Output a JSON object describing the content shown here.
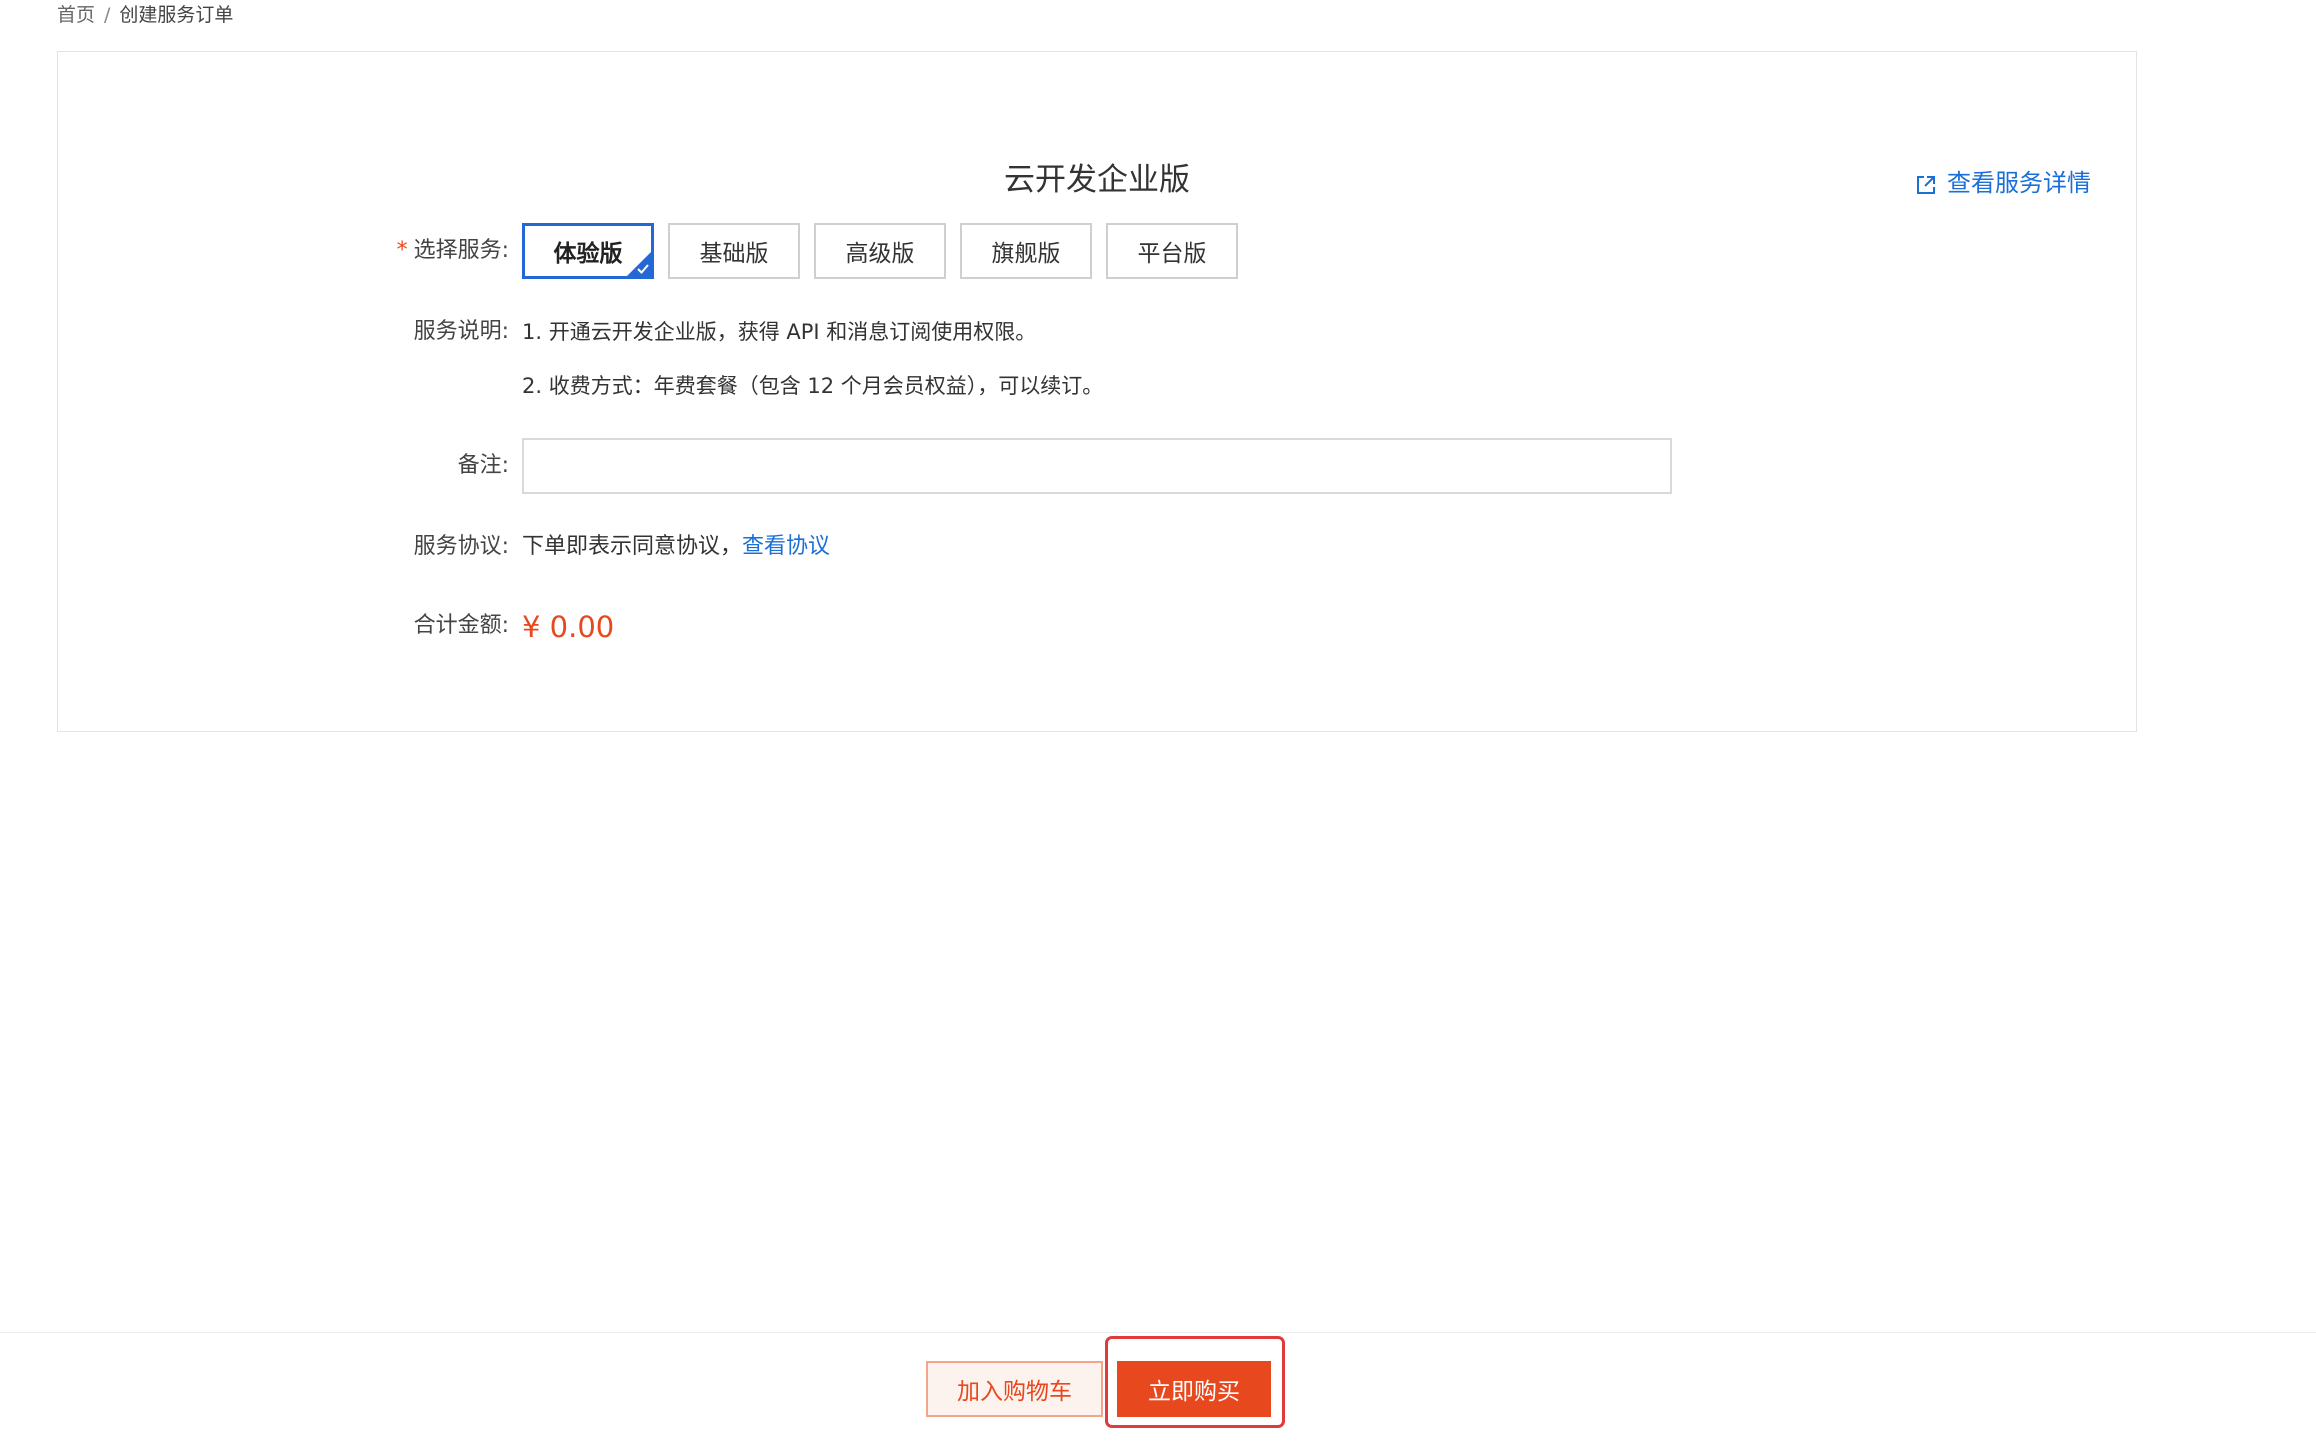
{
  "breadcrumb": {
    "home": "首页",
    "separator": "/",
    "current": "创建服务订单"
  },
  "card": {
    "title": "云开发企业版",
    "detail_link": "查看服务详情"
  },
  "service_select": {
    "required_mark": "*",
    "label": "选择服务:",
    "options": [
      "体验版",
      "基础版",
      "高级版",
      "旗舰版",
      "平台版"
    ],
    "selected": "体验版"
  },
  "description": {
    "label": "服务说明:",
    "lines": [
      "1. 开通云开发企业版，获得 API 和消息订阅使用权限。",
      "2. 收费方式：年费套餐（包含 12 个月会员权益），可以续订。"
    ]
  },
  "remark": {
    "label": "备注:",
    "value": "",
    "placeholder": ""
  },
  "agreement": {
    "label": "服务协议:",
    "text": "下单即表示同意协议，",
    "link": "查看协议"
  },
  "total": {
    "label": "合计金额:",
    "amount": "¥ 0.00"
  },
  "actions": {
    "add_to_cart": "加入购物车",
    "buy_now": "立即购买"
  },
  "colors": {
    "accent_blue": "#2468d6",
    "link_blue": "#1a6fd8",
    "brand_orange": "#e8481e",
    "highlight_red": "#e13a3a"
  }
}
